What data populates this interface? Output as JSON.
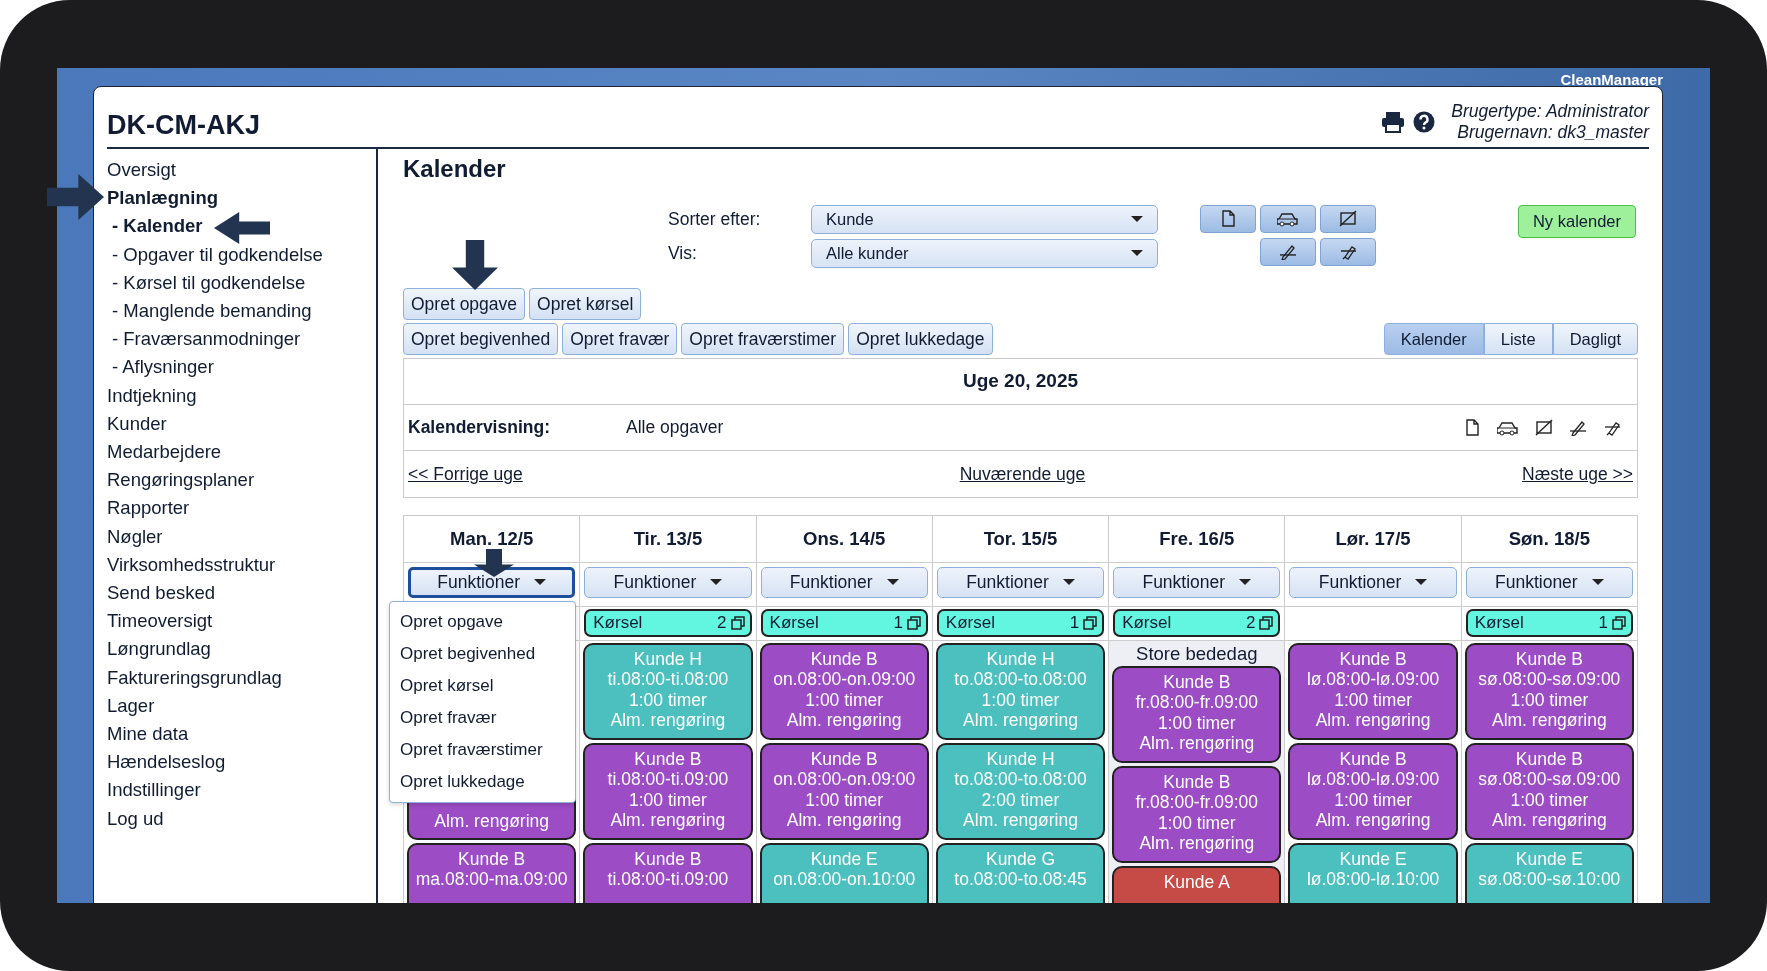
{
  "app_name": "CleanManager",
  "header": {
    "title": "DK-CM-AKJ",
    "user_type": "Brugertype: Administrator",
    "user_name": "Brugernavn: dk3_master"
  },
  "sidebar": {
    "items": [
      {
        "label": "Oversigt",
        "selected": false
      },
      {
        "label": "Planlægning",
        "selected": true,
        "children": [
          {
            "label": "- Kalender",
            "selected": true
          },
          {
            "label": "- Opgaver til godkendelse",
            "selected": false
          },
          {
            "label": "- Kørsel til godkendelse",
            "selected": false
          },
          {
            "label": "- Manglende bemanding",
            "selected": false
          },
          {
            "label": "- Fraværsanmodninger",
            "selected": false
          },
          {
            "label": "- Aflysninger",
            "selected": false
          }
        ]
      },
      {
        "label": "Indtjekning",
        "selected": false
      },
      {
        "label": "Kunder",
        "selected": false
      },
      {
        "label": "Medarbejdere",
        "selected": false
      },
      {
        "label": "Rengøringsplaner",
        "selected": false
      },
      {
        "label": "Rapporter",
        "selected": false
      },
      {
        "label": "Nøgler",
        "selected": false
      },
      {
        "label": "Virksomhedsstruktur",
        "selected": false
      },
      {
        "label": "Send besked",
        "selected": false
      },
      {
        "label": "Timeoversigt",
        "selected": false
      },
      {
        "label": "Løngrundlag",
        "selected": false
      },
      {
        "label": "Faktureringsgrundlag",
        "selected": false
      },
      {
        "label": "Lager",
        "selected": false
      },
      {
        "label": "Mine data",
        "selected": false
      },
      {
        "label": "Hændelseslog",
        "selected": false
      },
      {
        "label": "Indstillinger",
        "selected": false
      },
      {
        "label": "Log ud",
        "selected": false
      }
    ]
  },
  "page": {
    "title": "Kalender"
  },
  "filters": [
    {
      "label": "Sorter efter:",
      "value": "Kunde"
    },
    {
      "label": "Vis:",
      "value": "Alle kunder"
    }
  ],
  "new_calendar_button": "Ny kalender",
  "action_rows": [
    [
      "Opret opgave",
      "Opret kørsel"
    ],
    [
      "Opret begivenhed",
      "Opret fravær",
      "Opret fraværstimer",
      "Opret lukkedage"
    ]
  ],
  "view_tabs": [
    {
      "label": "Kalender",
      "selected": true
    },
    {
      "label": "Liste",
      "selected": false
    },
    {
      "label": "Dagligt",
      "selected": false
    }
  ],
  "week": {
    "title": "Uge 20, 2025",
    "view_label": "Kalendervisning:",
    "view_value": "Alle opgaver",
    "prev": "<< Forrige uge",
    "current": "Nuværende uge",
    "next": "Næste uge >>"
  },
  "days": [
    {
      "label": "Man. 12/5",
      "functions": "Funktioner",
      "expanded": true,
      "menu": [
        "Opret opgave",
        "Opret begivenhed",
        "Opret kørsel",
        "Opret fravær",
        "Opret fraværstimer",
        "Opret lukkedage"
      ],
      "holiday": false,
      "events": [
        {
          "kind": "covered"
        },
        {
          "kind": "partial",
          "color": "#9c4cc4",
          "lines": [
            "Alm. rengøring"
          ]
        },
        {
          "kind": "card",
          "color": "#9c4cc4",
          "lines": [
            "Kunde B",
            "ma.08:00-ma.09:00"
          ]
        }
      ]
    },
    {
      "label": "Tir. 13/5",
      "functions": "Funktioner",
      "expanded": false,
      "korsel": {
        "label": "Kørsel",
        "count": "2"
      },
      "holiday": false,
      "events": [
        {
          "kind": "card",
          "color": "#4cbfbf",
          "lines": [
            "Kunde H",
            "ti.08:00-ti.08:00",
            "1:00 timer",
            "Alm. rengøring"
          ]
        },
        {
          "kind": "card",
          "color": "#9c4cc4",
          "lines": [
            "Kunde B",
            "ti.08:00-ti.09:00",
            "1:00 timer",
            "Alm. rengøring"
          ]
        },
        {
          "kind": "card",
          "color": "#9c4cc4",
          "lines": [
            "Kunde B",
            "ti.08:00-ti.09:00"
          ]
        }
      ]
    },
    {
      "label": "Ons. 14/5",
      "functions": "Funktioner",
      "expanded": false,
      "korsel": {
        "label": "Kørsel",
        "count": "1"
      },
      "holiday": false,
      "events": [
        {
          "kind": "card",
          "color": "#9c4cc4",
          "lines": [
            "Kunde B",
            "on.08:00-on.09:00",
            "1:00 timer",
            "Alm. rengøring"
          ]
        },
        {
          "kind": "card",
          "color": "#9c4cc4",
          "lines": [
            "Kunde B",
            "on.08:00-on.09:00",
            "1:00 timer",
            "Alm. rengøring"
          ]
        },
        {
          "kind": "card",
          "color": "#4cbfbf",
          "lines": [
            "Kunde E",
            "on.08:00-on.10:00"
          ]
        }
      ]
    },
    {
      "label": "Tor. 15/5",
      "functions": "Funktioner",
      "expanded": false,
      "korsel": {
        "label": "Kørsel",
        "count": "1"
      },
      "holiday": false,
      "events": [
        {
          "kind": "card",
          "color": "#4cbfbf",
          "lines": [
            "Kunde H",
            "to.08:00-to.08:00",
            "1:00 timer",
            "Alm. rengøring"
          ]
        },
        {
          "kind": "card",
          "color": "#4cbfbf",
          "lines": [
            "Kunde H",
            "to.08:00-to.08:00",
            "2:00 timer",
            "Alm. rengøring"
          ]
        },
        {
          "kind": "card",
          "color": "#4cbfbf",
          "lines": [
            "Kunde G",
            "to.08:00-to.08:45"
          ]
        }
      ]
    },
    {
      "label": "Fre. 16/5",
      "functions": "Funktioner",
      "expanded": false,
      "korsel": {
        "label": "Kørsel",
        "count": "2"
      },
      "holiday": true,
      "note": "Store bededag",
      "events": [
        {
          "kind": "card",
          "color": "#9c4cc4",
          "lines": [
            "Kunde B",
            "fr.08:00-fr.09:00",
            "1:00 timer",
            "Alm. rengøring"
          ]
        },
        {
          "kind": "card",
          "color": "#9c4cc4",
          "lines": [
            "Kunde B",
            "fr.08:00-fr.09:00",
            "1:00 timer",
            "Alm. rengøring"
          ]
        },
        {
          "kind": "card",
          "color": "#c64a46",
          "lines": [
            "Kunde A"
          ]
        }
      ]
    },
    {
      "label": "Lør. 17/5",
      "functions": "Funktioner",
      "expanded": false,
      "holiday": false,
      "events": [
        {
          "kind": "card",
          "color": "#9c4cc4",
          "lines": [
            "Kunde B",
            "lø.08:00-lø.09:00",
            "1:00 timer",
            "Alm. rengøring"
          ]
        },
        {
          "kind": "card",
          "color": "#9c4cc4",
          "lines": [
            "Kunde B",
            "lø.08:00-lø.09:00",
            "1:00 timer",
            "Alm. rengøring"
          ]
        },
        {
          "kind": "card",
          "color": "#4cbfbf",
          "lines": [
            "Kunde E",
            "lø.08:00-lø.10:00"
          ]
        }
      ]
    },
    {
      "label": "Søn. 18/5",
      "functions": "Funktioner",
      "expanded": false,
      "korsel": {
        "label": "Kørsel",
        "count": "1"
      },
      "holiday": false,
      "events": [
        {
          "kind": "card",
          "color": "#9c4cc4",
          "lines": [
            "Kunde B",
            "sø.08:00-sø.09:00",
            "1:00 timer",
            "Alm. rengøring"
          ]
        },
        {
          "kind": "card",
          "color": "#9c4cc4",
          "lines": [
            "Kunde B",
            "sø.08:00-sø.09:00",
            "1:00 timer",
            "Alm. rengøring"
          ]
        },
        {
          "kind": "card",
          "color": "#4cbfbf",
          "lines": [
            "Kunde E",
            "sø.08:00-sø.10:00"
          ]
        }
      ]
    }
  ]
}
